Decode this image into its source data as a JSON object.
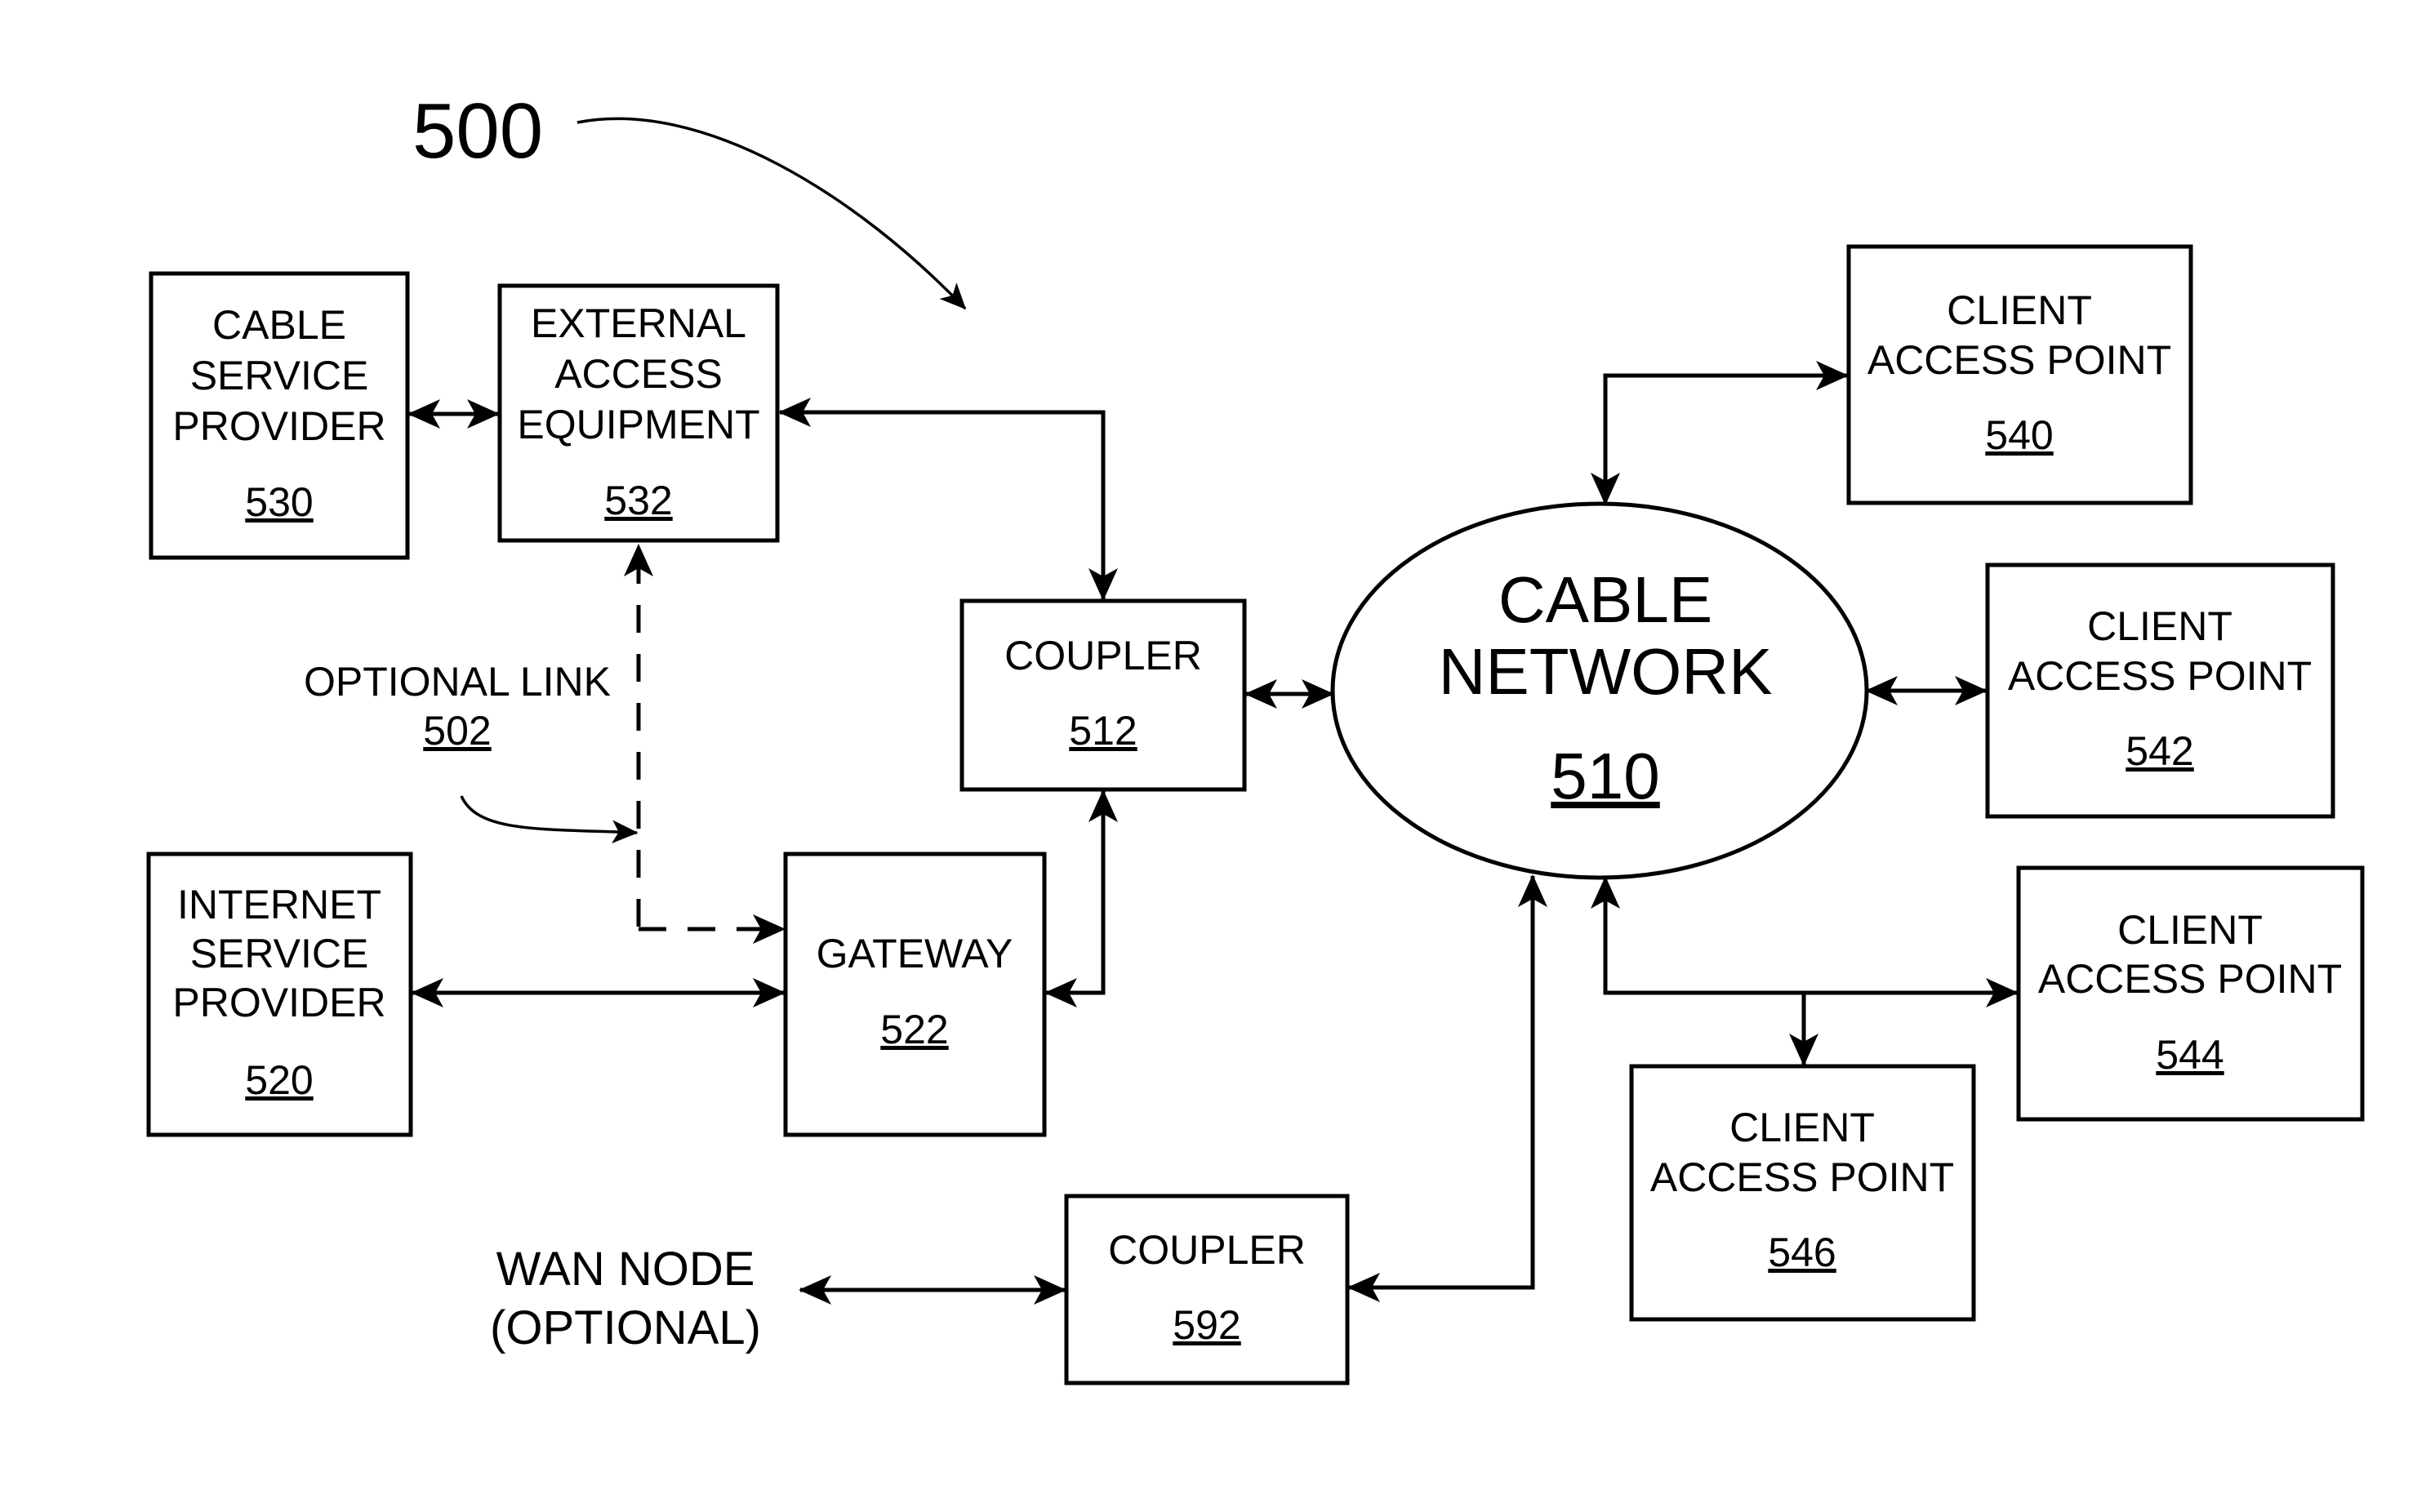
{
  "figure": {
    "ref_number": "500"
  },
  "nodes": {
    "cable_service_provider": {
      "lines": [
        "CABLE",
        "SERVICE",
        "PROVIDER"
      ],
      "ref": "530"
    },
    "external_access_equipment": {
      "lines": [
        "EXTERNAL",
        "ACCESS",
        "EQUIPMENT"
      ],
      "ref": "532"
    },
    "internet_service_provider": {
      "lines": [
        "INTERNET",
        "SERVICE",
        "PROVIDER"
      ],
      "ref": "520"
    },
    "gateway": {
      "lines": [
        "GATEWAY"
      ],
      "ref": "522"
    },
    "coupler_512": {
      "lines": [
        "COUPLER"
      ],
      "ref": "512"
    },
    "coupler_592": {
      "lines": [
        "COUPLER"
      ],
      "ref": "592"
    },
    "cable_network": {
      "lines": [
        "CABLE",
        "NETWORK"
      ],
      "ref": "510"
    },
    "client_540": {
      "lines": [
        "CLIENT",
        "ACCESS POINT"
      ],
      "ref": "540"
    },
    "client_542": {
      "lines": [
        "CLIENT",
        "ACCESS POINT"
      ],
      "ref": "542"
    },
    "client_544": {
      "lines": [
        "CLIENT",
        "ACCESS POINT"
      ],
      "ref": "544"
    },
    "client_546": {
      "lines": [
        "CLIENT",
        "ACCESS POINT"
      ],
      "ref": "546"
    },
    "wan_node": {
      "lines": [
        "WAN NODE",
        "(OPTIONAL)"
      ]
    }
  },
  "annotations": {
    "optional_link": {
      "label": "OPTIONAL LINK",
      "ref": "502"
    }
  },
  "connections": [
    {
      "from": "530",
      "to": "532",
      "type": "bidirectional"
    },
    {
      "from": "532",
      "to": "512",
      "type": "bidirectional"
    },
    {
      "from": "532",
      "to": "522",
      "type": "optional-dashed"
    },
    {
      "from": "520",
      "to": "522",
      "type": "bidirectional"
    },
    {
      "from": "522",
      "to": "512",
      "type": "bidirectional"
    },
    {
      "from": "512",
      "to": "510",
      "type": "bidirectional"
    },
    {
      "from": "510",
      "to": "540",
      "type": "bidirectional"
    },
    {
      "from": "510",
      "to": "542",
      "type": "bidirectional"
    },
    {
      "from": "510",
      "to": "544",
      "type": "bidirectional"
    },
    {
      "from": "510",
      "to": "546",
      "type": "bidirectional"
    },
    {
      "from": "510",
      "to": "592",
      "type": "bidirectional"
    },
    {
      "from": "592",
      "to": "WAN NODE",
      "type": "bidirectional"
    }
  ]
}
